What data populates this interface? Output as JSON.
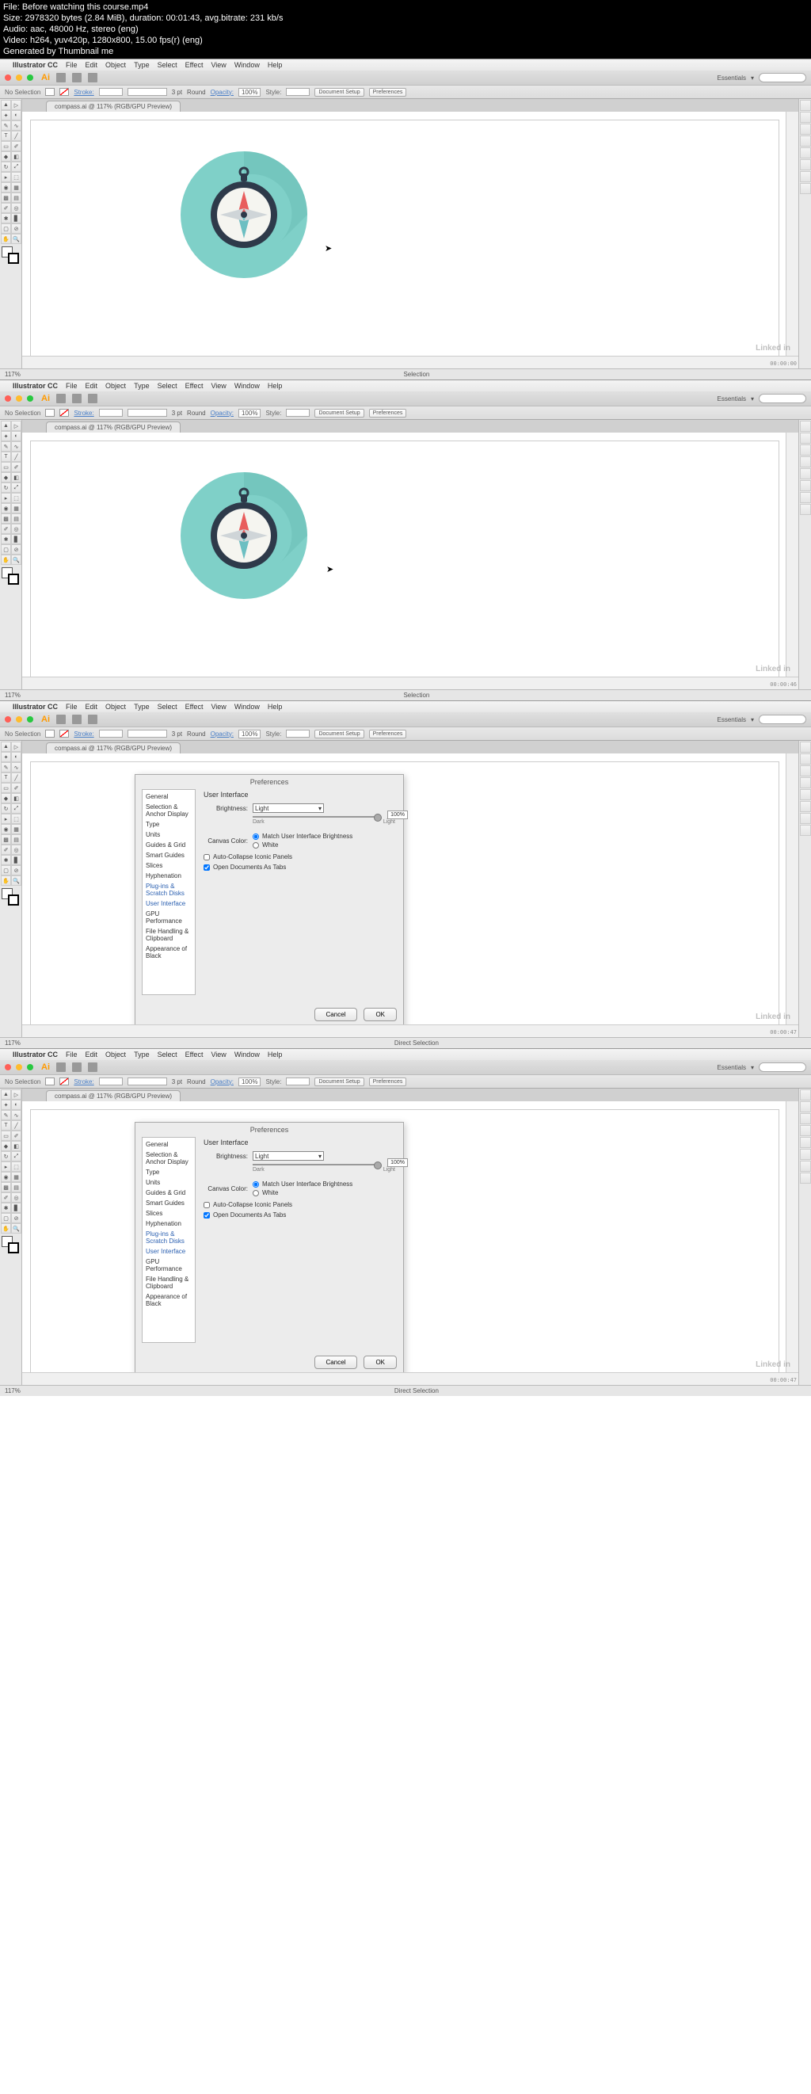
{
  "file_info": {
    "line1": "File: Before watching this course.mp4",
    "line2": "Size: 2978320 bytes (2.84 MiB), duration: 00:01:43, avg.bitrate: 231 kb/s",
    "line3": "Audio: aac, 48000 Hz, stereo (eng)",
    "line4": "Video: h264, yuv420p, 1280x800, 15.00 fps(r) (eng)",
    "line5": "Generated by Thumbnail me"
  },
  "menubar": {
    "app": "Illustrator CC",
    "items": [
      "File",
      "Edit",
      "Object",
      "Type",
      "Select",
      "Effect",
      "View",
      "Window",
      "Help"
    ]
  },
  "titlebar": {
    "right_label": "Essentials",
    "search_placeholder": ""
  },
  "controlbar": {
    "left_label": "No Selection",
    "stroke_label": "Stroke:",
    "weight": "3 pt",
    "profile": "Round",
    "opacity_label": "Opacity:",
    "opacity_val": "100%",
    "style_label": "Style:",
    "btns": [
      "Document Setup",
      "Preferences"
    ]
  },
  "doc_tab": "compass.ai @ 117% (RGB/GPU Preview)",
  "statusbar": {
    "zoom": "117%",
    "sel_mode_a": "Selection",
    "sel_mode_b": "Direct Selection",
    "ts1": "00:00:00",
    "ts2": "00:00:46",
    "ts3": "00:00:47",
    "ts4": "00:00:47"
  },
  "prefs": {
    "title": "Preferences",
    "sidebar": [
      "General",
      "Selection & Anchor Display",
      "Type",
      "Units",
      "Guides & Grid",
      "Smart Guides",
      "Slices",
      "Hyphenation",
      "Plug-ins & Scratch Disks",
      "User Interface",
      "GPU Performance",
      "File Handling & Clipboard",
      "Appearance of Black"
    ],
    "content": {
      "heading": "User Interface",
      "brightness_label": "Brightness:",
      "brightness_value": "Light",
      "slider_dark": "Dark",
      "slider_light": "Light",
      "slider_pct": "100%",
      "canvas_label": "Canvas Color:",
      "radio_match": "Match User Interface Brightness",
      "radio_white": "White",
      "check_collapse": "Auto-Collapse Iconic Panels",
      "check_tabs": "Open Documents As Tabs"
    },
    "footer": {
      "cancel": "Cancel",
      "ok": "OK"
    }
  },
  "watermark": "Linked in"
}
